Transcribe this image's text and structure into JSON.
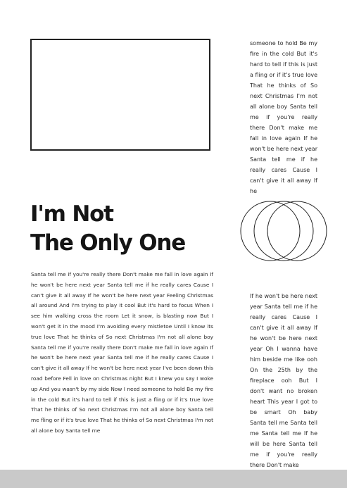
{
  "headline": {
    "line1": "I'm Not",
    "line2": "The Only One"
  },
  "sidebar_top_text": "someone to hold Be my fire in the cold But it's hard to tell if this is just a fling or if it's true love That he thinks of So next Christmas I'm not all alone boy Santa tell me if you're really there Don't make me fall in love again If he won't be here next year Santa tell me if he really cares Cause I can't give it all away If he",
  "body_text": "Santa tell me if you're really there Don't make me fall in love again If he won't be here next year Santa tell me if he really cares Cause I can't give it all away If he won't be here next year Feeling Christmas all around And I'm trying to play it cool But it's hard to focus When I see him walking cross the room Let it snow, is blasting now But I won't get it in the mood I'm avoiding every mistletoe Until I know its true love That he thinks of So next Christmas I'm not all alone boy Santa tell me if you're really there Don't make me fall in love again If he won't be here next year Santa tell me if he really cares Cause I can't give it all away If he won't be here next year I've been down this road before Fell in love on Christmas night But I knew you say I woke up And you wasn't by my side Now I need someone to hold Be my fire in the cold But it's hard to tell if this is just a fling or if it's true love That he thinks of So next Christmas I'm not all alone boy Santa tell me fling or if it's true love That he thinks of So next Christmas I'm not all alone boy Santa tell me",
  "sidebar_bottom_text": "If he won't be here next year Santa tell me if he really cares Cause I can't give it all away If he won't be here next year Oh I wanna have him beside me like ooh On the 25th by the fireplace ooh But I don't want no broken heart This year I got to be smart Oh baby Santa tell me Santa tell me Santa tell me If he will be here Santa tell me if you're really there Don't make",
  "colors": {
    "text": "#2a2a2a",
    "frame": "#222222",
    "footer": "#c9c9c9",
    "circles": "#222222"
  },
  "icons": {
    "image_placeholder": "empty-image-frame",
    "decoration": "three-overlapping-circles"
  }
}
